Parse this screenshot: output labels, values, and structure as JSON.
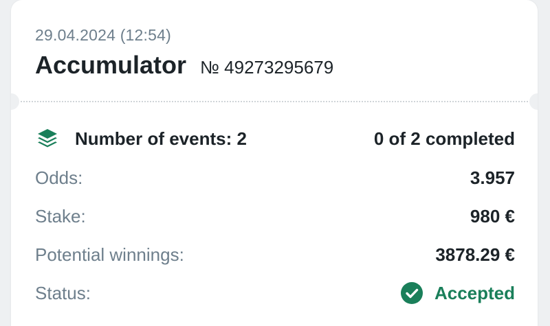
{
  "bet": {
    "date": "29.04.2024 (12:54)",
    "title": "Accumulator",
    "number": "№ 49273295679"
  },
  "summary": {
    "events_label": "Number of events: 2",
    "events_icon": "layers-icon",
    "completed": "0 of 2 completed"
  },
  "details": {
    "odds_label": "Odds:",
    "odds_value": "3.957",
    "stake_label": "Stake:",
    "stake_value": "980 €",
    "winnings_label": "Potential winnings:",
    "winnings_value": "3878.29 €",
    "status_label": "Status:",
    "status_value": "Accepted",
    "status_icon": "check-circle-icon"
  },
  "colors": {
    "accent": "#1a7f5a",
    "muted_text": "#6e7f8c",
    "text": "#1c2328"
  }
}
